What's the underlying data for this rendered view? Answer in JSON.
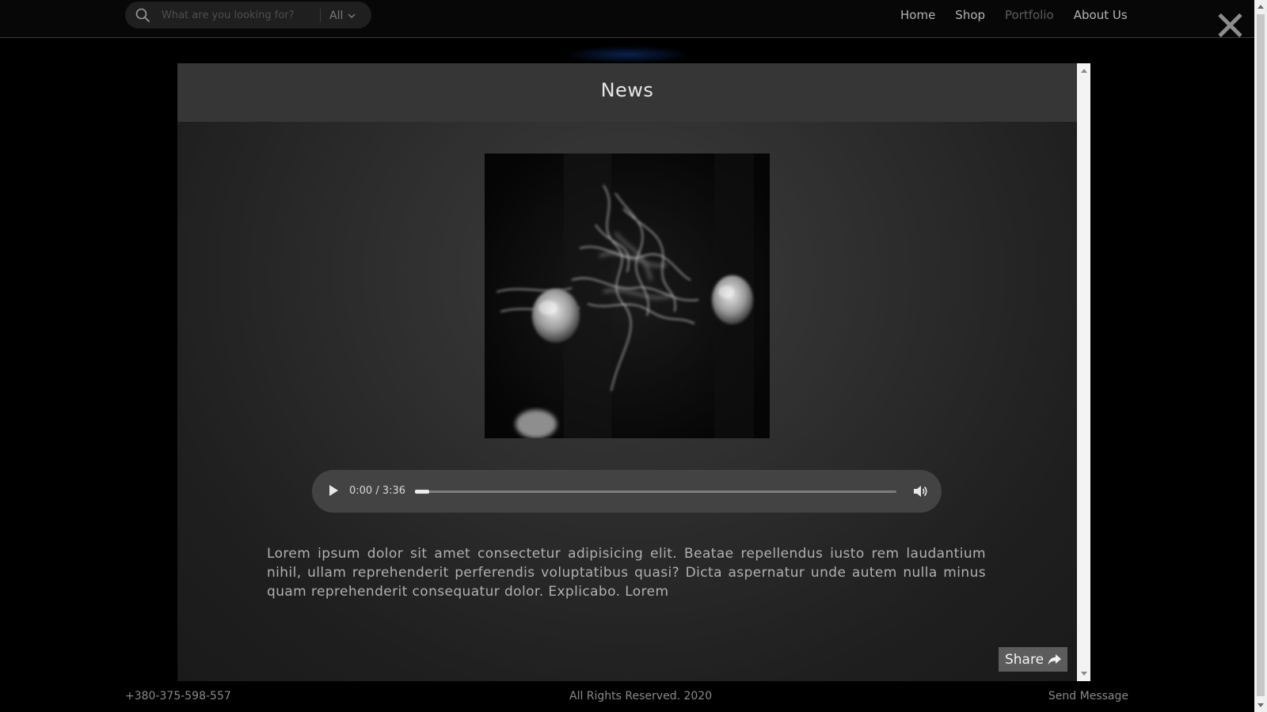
{
  "header": {
    "search": {
      "placeholder": "What are you looking for?",
      "value": "",
      "category": "All"
    },
    "nav": [
      {
        "label": "Home",
        "active": false
      },
      {
        "label": "Shop",
        "active": false
      },
      {
        "label": "Portfolio",
        "active": true
      },
      {
        "label": "About Us",
        "active": false
      }
    ]
  },
  "modal": {
    "title": "News",
    "image": {
      "subject": "smoke-and-flowers-photo"
    },
    "audio": {
      "current_time": "0:00",
      "duration": "3:36",
      "time_display": "0:00 / 3:36",
      "progress": 0.0
    },
    "body_text": "Lorem ipsum dolor sit amet consectetur adipisicing elit. Beatae repellendus iusto rem laudantium nihil, ullam reprehenderit perferendis voluptatibus quasi? Dicta aspernatur unde autem nulla minus quam reprehenderit consequatur dolor. Explicabo. Lorem",
    "share_label": "Share"
  },
  "footer": {
    "phone": "+380-375-598-557",
    "copyright": "All Rights Reserved. 2020",
    "send_message": "Send Message"
  },
  "colors": {
    "page_background": "#000000",
    "modal_header": "#363636",
    "share_button": "#5c5c5c",
    "audio_bar": "#434343"
  },
  "icons": [
    "search-icon",
    "chevron-down-icon",
    "close-icon",
    "play-icon",
    "volume-icon",
    "share-arrow-icon"
  ]
}
